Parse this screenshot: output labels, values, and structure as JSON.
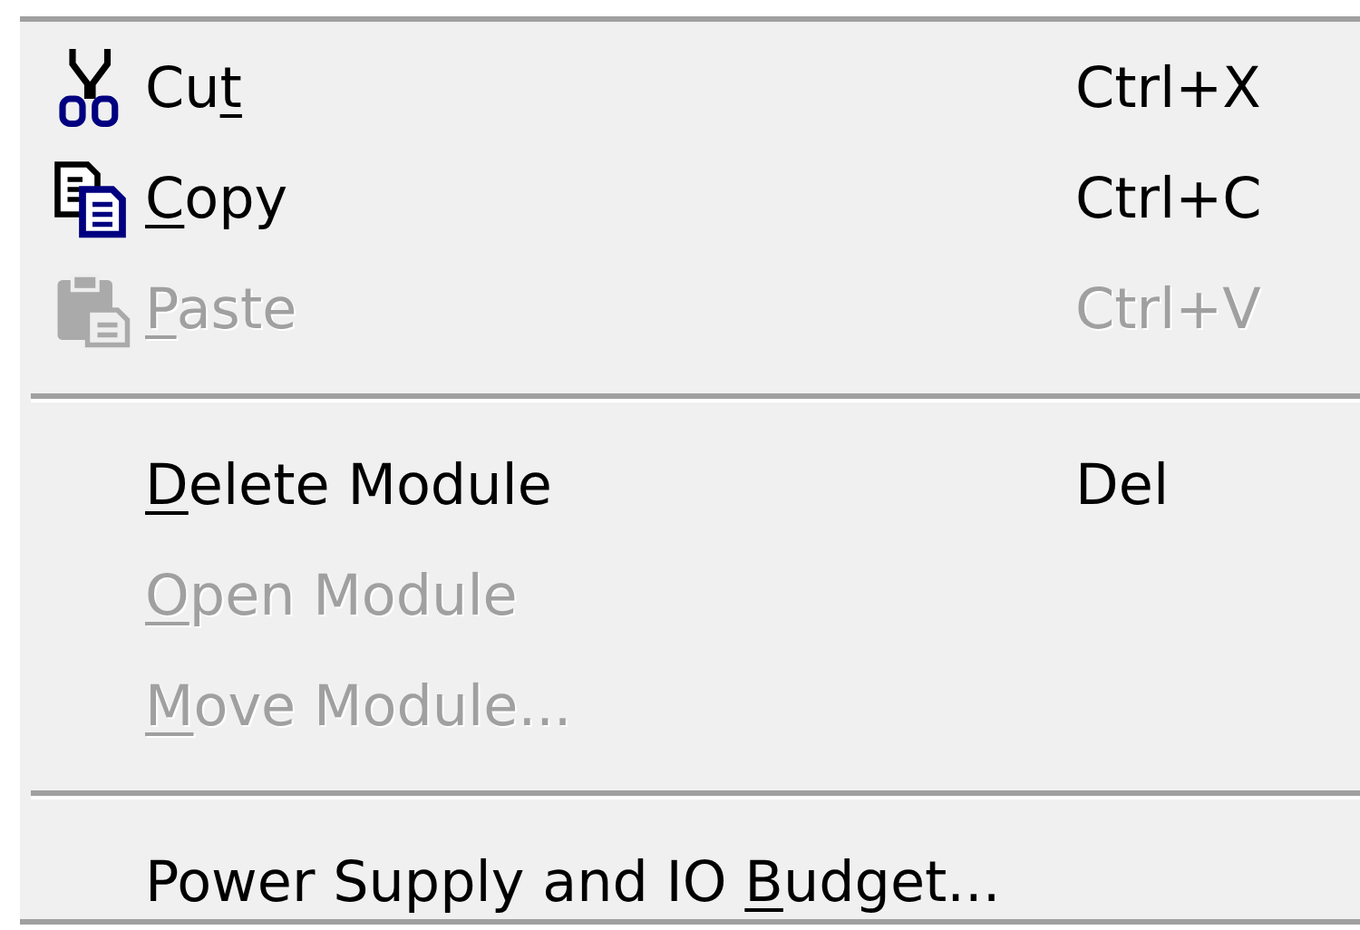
{
  "context_menu": {
    "items": [
      {
        "kind": "command",
        "label": "Cut",
        "shortcut": "Ctrl+X",
        "disabled": false
      },
      {
        "kind": "command",
        "label": "Copy",
        "shortcut": "Ctrl+C",
        "disabled": false
      },
      {
        "kind": "command",
        "label": "Paste",
        "shortcut": "Ctrl+V",
        "disabled": true
      },
      {
        "kind": "separator"
      },
      {
        "kind": "command",
        "label": "Delete Module",
        "shortcut": "Del",
        "disabled": false
      },
      {
        "kind": "command",
        "label": "Open Module",
        "disabled": true
      },
      {
        "kind": "command",
        "label": "Move Module...",
        "disabled": true
      },
      {
        "kind": "separator"
      },
      {
        "kind": "command",
        "label": "Power Supply and IO Budget...",
        "disabled": false
      }
    ]
  }
}
